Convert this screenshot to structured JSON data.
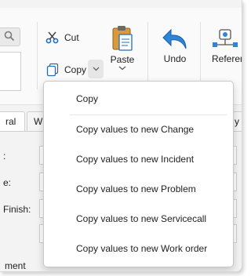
{
  "ribbon": {
    "cut_label": "Cut",
    "copy_label": "Copy",
    "paste_label": "Paste",
    "undo_label": "Undo",
    "reference_label": "Referen",
    "search_icon": "search-icon",
    "accent_color": "#1e6fbf"
  },
  "tabs": [
    {
      "label": "ral"
    },
    {
      "label": "W"
    },
    {
      "label": "y"
    }
  ],
  "form": {
    "labels": [
      ":",
      "e:",
      "Finish:"
    ],
    "bottom_label": "ment"
  },
  "menu": {
    "items": [
      {
        "label": "Copy"
      },
      {
        "label": "Copy values to new Change"
      },
      {
        "label": "Copy values to new Incident"
      },
      {
        "label": "Copy values to new Problem"
      },
      {
        "label": "Copy values to new Servicecall"
      },
      {
        "label": "Copy values to new Work order"
      }
    ]
  }
}
